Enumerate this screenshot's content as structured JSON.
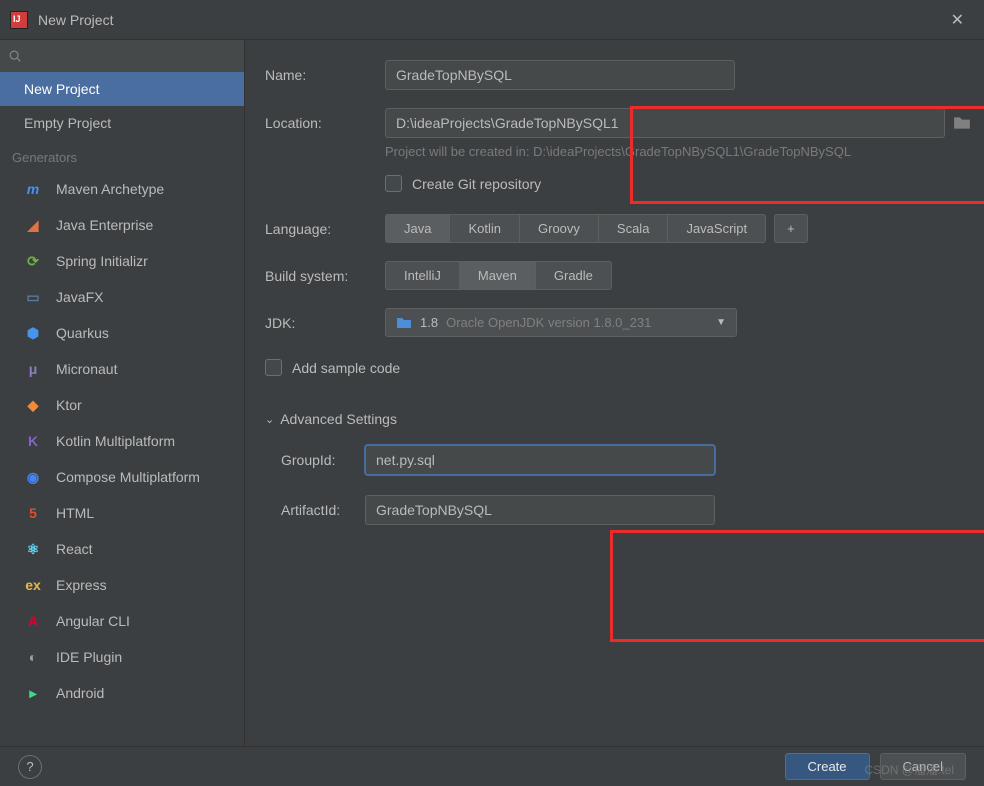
{
  "window": {
    "title": "New Project",
    "close": "✕"
  },
  "sidebar": {
    "items": [
      {
        "label": "New Project"
      },
      {
        "label": "Empty Project"
      }
    ],
    "generators_header": "Generators",
    "generators": [
      {
        "label": "Maven Archetype",
        "icon_color": "#4b8ff0",
        "glyph": "m"
      },
      {
        "label": "Java Enterprise",
        "icon_color": "#e07340",
        "glyph": "◢"
      },
      {
        "label": "Spring Initializr",
        "icon_color": "#6db33f",
        "glyph": "⟳"
      },
      {
        "label": "JavaFX",
        "icon_color": "#5a7a9c",
        "glyph": "▭"
      },
      {
        "label": "Quarkus",
        "icon_color": "#4695eb",
        "glyph": "⬢"
      },
      {
        "label": "Micronaut",
        "icon_color": "#8f7cc3",
        "glyph": "μ"
      },
      {
        "label": "Ktor",
        "icon_color": "#f08a3c",
        "glyph": "◆"
      },
      {
        "label": "Kotlin Multiplatform",
        "icon_color": "#8860d0",
        "glyph": "K"
      },
      {
        "label": "Compose Multiplatform",
        "icon_color": "#4285f4",
        "glyph": "◉"
      },
      {
        "label": "HTML",
        "icon_color": "#e44d26",
        "glyph": "5"
      },
      {
        "label": "React",
        "icon_color": "#61dafb",
        "glyph": "⚛"
      },
      {
        "label": "Express",
        "icon_color": "#e8b750",
        "glyph": "ex"
      },
      {
        "label": "Angular CLI",
        "icon_color": "#dd0031",
        "glyph": "A"
      },
      {
        "label": "IDE Plugin",
        "icon_color": "#9aa0a6",
        "glyph": "◐"
      },
      {
        "label": "Android",
        "icon_color": "#3ddc84",
        "glyph": "▸"
      }
    ]
  },
  "form": {
    "name_label": "Name:",
    "name_value": "GradeTopNBySQL",
    "location_label": "Location:",
    "location_value": "D:\\ideaProjects\\GradeTopNBySQL1",
    "location_hint": "Project will be created in: D:\\ideaProjects\\GradeTopNBySQL1\\GradeTopNBySQL",
    "create_git_label": "Create Git repository",
    "language_label": "Language:",
    "languages": [
      "Java",
      "Kotlin",
      "Groovy",
      "Scala",
      "JavaScript"
    ],
    "language_plus": "+",
    "build_label": "Build system:",
    "builds": [
      "IntelliJ",
      "Maven",
      "Gradle"
    ],
    "jdk_label": "JDK:",
    "jdk_version": "1.8",
    "jdk_desc": "Oracle OpenJDK version 1.8.0_231",
    "add_sample_label": "Add sample code",
    "advanced_header": "Advanced Settings",
    "group_id_label": "GroupId:",
    "group_id_value": "net.py.sql",
    "artifact_id_label": "ArtifactId:",
    "artifact_id_value": "GradeTopNBySQL"
  },
  "footer": {
    "help": "?",
    "create": "Create",
    "cancel": "Cancel"
  },
  "watermark": "CSDN @潘潘.tel"
}
